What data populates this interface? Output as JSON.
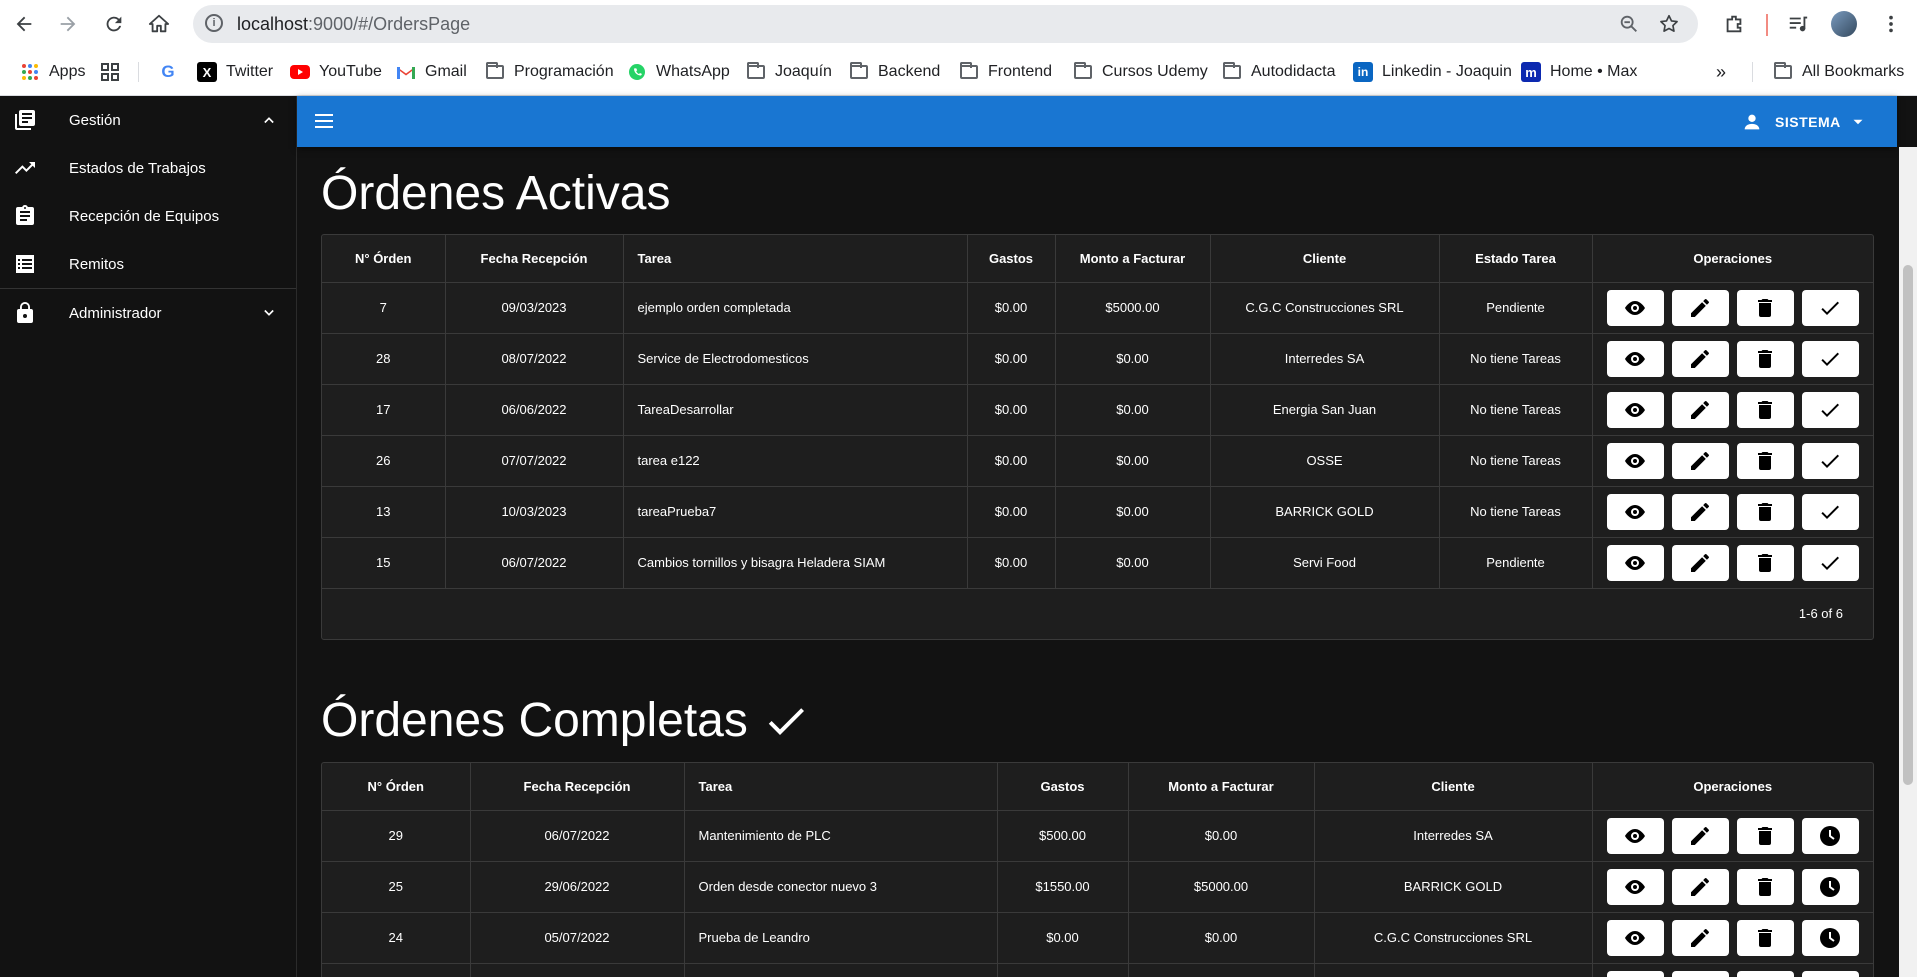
{
  "browser": {
    "url_host": "localhost",
    "url_rest": ":9000/#/OrdersPage",
    "bookmarks": [
      {
        "label": "Apps",
        "icon": "apps-icon"
      },
      {
        "label": "",
        "icon": "grid-icon"
      },
      {
        "label": "",
        "icon": "google-icon"
      },
      {
        "label": "Twitter",
        "icon": "x-icon"
      },
      {
        "label": "YouTube",
        "icon": "youtube-icon"
      },
      {
        "label": "Gmail",
        "icon": "gmail-icon"
      },
      {
        "label": "Programación",
        "icon": "folder-icon"
      },
      {
        "label": "WhatsApp",
        "icon": "whatsapp-icon"
      },
      {
        "label": "Joaquín",
        "icon": "folder-icon"
      },
      {
        "label": "Backend",
        "icon": "folder-icon"
      },
      {
        "label": "Frontend",
        "icon": "folder-icon"
      },
      {
        "label": "Cursos Udemy",
        "icon": "folder-icon"
      },
      {
        "label": "Autodidacta",
        "icon": "folder-icon"
      },
      {
        "label": "Linkedin - Joaquin",
        "icon": "linkedin-icon"
      },
      {
        "label": "Home • Max",
        "icon": "max-icon"
      }
    ],
    "more": "»",
    "all_bookmarks": "All Bookmarks"
  },
  "sidebar": {
    "items": [
      {
        "label": "Gestión",
        "icon": "library-books-icon",
        "expand": "up"
      },
      {
        "label": "Estados de Trabajos",
        "icon": "trending-up-icon"
      },
      {
        "label": "Recepción de Equipos",
        "icon": "clipboard-icon"
      },
      {
        "label": "Remitos",
        "icon": "list-alt-icon"
      },
      {
        "label": "Administrador",
        "icon": "lock-icon",
        "expand": "down"
      }
    ]
  },
  "appbar": {
    "user": "SISTEMA"
  },
  "active": {
    "title": "Órdenes Activas",
    "headers": [
      "N° Órden",
      "Fecha Recepción",
      "Tarea",
      "Gastos",
      "Monto a Facturar",
      "Cliente",
      "Estado Tarea",
      "Operaciones"
    ],
    "rows": [
      [
        "7",
        "09/03/2023",
        "ejemplo orden completada",
        "$0.00",
        "$5000.00",
        "C.G.C Construcciones SRL",
        "Pendiente"
      ],
      [
        "28",
        "08/07/2022",
        "Service de Electrodomesticos",
        "$0.00",
        "$0.00",
        "Interredes SA",
        "No tiene Tareas"
      ],
      [
        "17",
        "06/06/2022",
        "TareaDesarrollar",
        "$0.00",
        "$0.00",
        "Energia San Juan",
        "No tiene Tareas"
      ],
      [
        "26",
        "07/07/2022",
        "tarea e122",
        "$0.00",
        "$0.00",
        "OSSE",
        "No tiene Tareas"
      ],
      [
        "13",
        "10/03/2023",
        "tareaPrueba7",
        "$0.00",
        "$0.00",
        "BARRICK GOLD",
        "No tiene Tareas"
      ],
      [
        "15",
        "06/07/2022",
        "Cambios tornillos y bisagra Heladera SIAM",
        "$0.00",
        "$0.00",
        "Servi Food",
        "Pendiente"
      ]
    ],
    "pager": "1-6 of 6"
  },
  "completed": {
    "title": "Órdenes Completas",
    "headers": [
      "N° Órden",
      "Fecha Recepción",
      "Tarea",
      "Gastos",
      "Monto a Facturar",
      "Cliente",
      "Operaciones"
    ],
    "rows": [
      [
        "29",
        "06/07/2022",
        "Mantenimiento de PLC",
        "$500.00",
        "$0.00",
        "Interredes SA"
      ],
      [
        "25",
        "29/06/2022",
        "Orden desde conector nuevo 3",
        "$1550.00",
        "$5000.00",
        "BARRICK GOLD"
      ],
      [
        "24",
        "05/07/2022",
        "Prueba de Leandro",
        "$0.00",
        "$0.00",
        "C.G.C Construcciones SRL"
      ],
      [
        "",
        "",
        "",
        "",
        "",
        "",
        ""
      ]
    ]
  },
  "colors": {
    "appbar": "#1976d2",
    "background": "#121212",
    "table": "#1e1e1e"
  }
}
